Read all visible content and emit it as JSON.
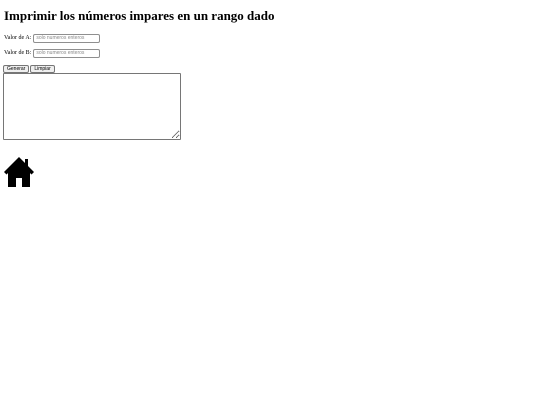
{
  "page": {
    "title": "Imprimir los números impares en un rango dado"
  },
  "form": {
    "field_a": {
      "label": "Valor de A:",
      "value": "",
      "placeholder": "solo numeros enteros"
    },
    "field_b": {
      "label": "Valor de B:",
      "value": "",
      "placeholder": "solo numeros enteros"
    },
    "buttons": {
      "generate_label": "Generar",
      "clear_label": "Limpiar"
    },
    "output": {
      "value": ""
    }
  },
  "home": {
    "icon": "home-icon",
    "color": "#000000"
  }
}
